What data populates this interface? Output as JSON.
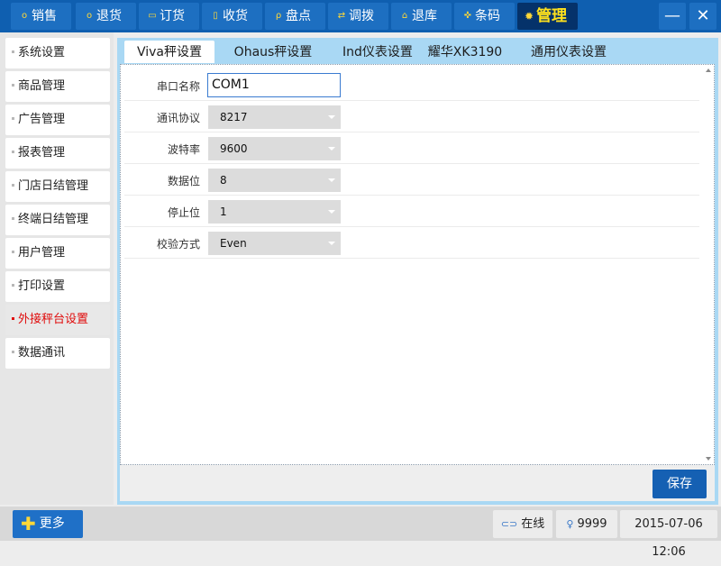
{
  "topbar": {
    "tabs": [
      {
        "label": "销售",
        "icon": "o"
      },
      {
        "label": "退货",
        "icon": "o"
      },
      {
        "label": "订货",
        "icon": "▭"
      },
      {
        "label": "收货",
        "icon": "▯"
      },
      {
        "label": "盘点",
        "icon": "ρ"
      },
      {
        "label": "调拨",
        "icon": "⇄"
      },
      {
        "label": "退库",
        "icon": "⌂"
      },
      {
        "label": "条码",
        "icon": "✜"
      },
      {
        "label": "管理",
        "icon": "✹"
      }
    ],
    "minimize": "—",
    "close": "✕"
  },
  "sidebar": {
    "items": [
      {
        "label": "系统设置"
      },
      {
        "label": "商品管理"
      },
      {
        "label": "广告管理"
      },
      {
        "label": "报表管理"
      },
      {
        "label": "门店日结管理"
      },
      {
        "label": "终端日结管理"
      },
      {
        "label": "用户管理"
      },
      {
        "label": "打印设置"
      },
      {
        "label": "外接秤台设置"
      },
      {
        "label": "数据通讯"
      }
    ],
    "active_index": 8
  },
  "panel": {
    "tabs": [
      {
        "label": "Viva秤设置"
      },
      {
        "label": "Ohaus秤设置"
      },
      {
        "label": "Ind仪表设置"
      },
      {
        "label": "耀华XK3190"
      },
      {
        "label": "通用仪表设置"
      }
    ],
    "active_tab": 0,
    "fields": {
      "port": {
        "label": "串口名称",
        "value": "COM1"
      },
      "protocol": {
        "label": "通讯协议",
        "value": "8217"
      },
      "baud": {
        "label": "波特率",
        "value": "9600"
      },
      "databits": {
        "label": "数据位",
        "value": "8"
      },
      "stopbits": {
        "label": "停止位",
        "value": "1"
      },
      "parity": {
        "label": "校验方式",
        "value": "Even"
      }
    },
    "save_label": "保存"
  },
  "statusbar": {
    "more_label": "更多",
    "online_label": "在线",
    "user": "9999",
    "datetime": "2015-07-06 12:06"
  },
  "colors": {
    "topbar_bg": "#0f5fb0",
    "tab_bg": "#1d6fc1",
    "active_tab_bg": "#05326a",
    "active_tab_text": "#ffe11c",
    "active_sidebar_text": "#e00b0b",
    "panel_tabbar": "#a9d8f4",
    "save_button": "#1560b3"
  }
}
